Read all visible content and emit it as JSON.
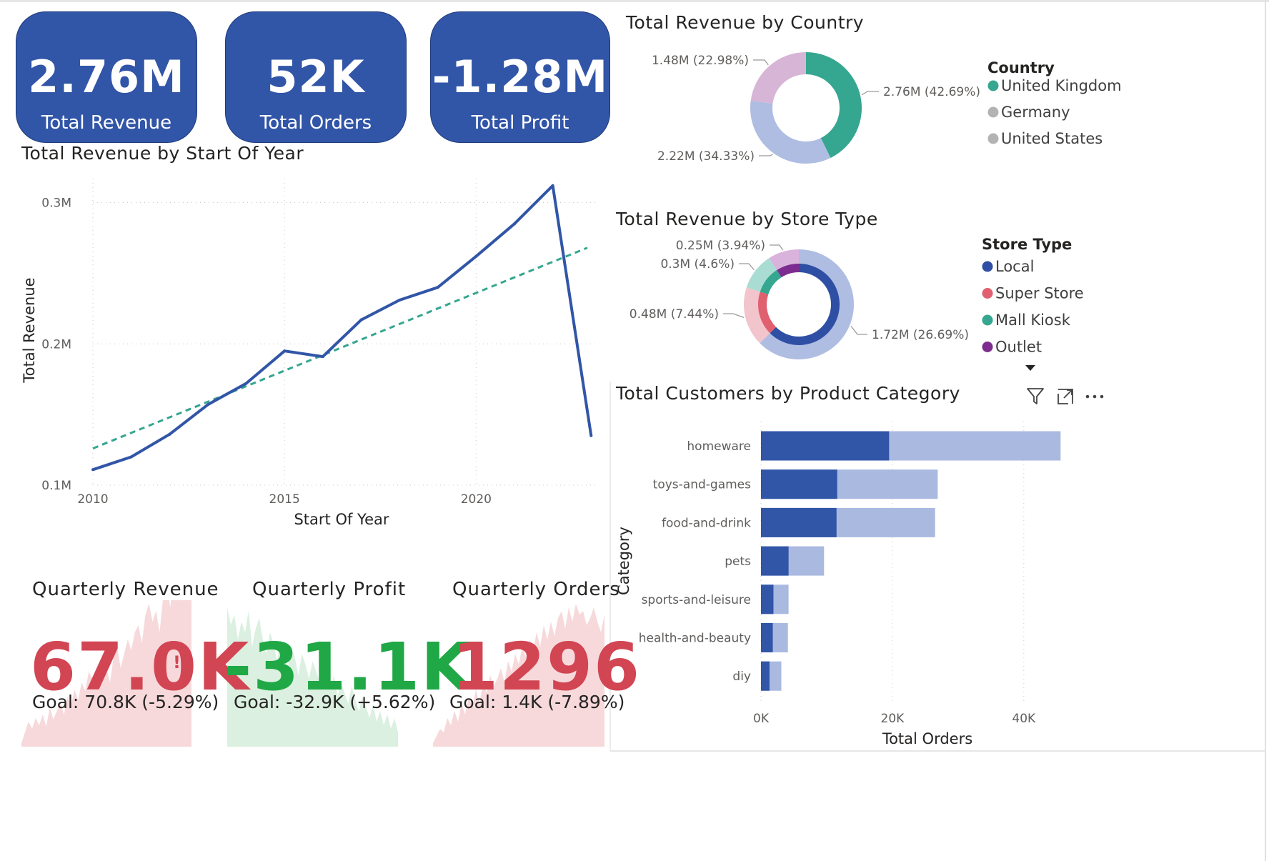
{
  "kpis": [
    {
      "value": "2.76M",
      "label": "Total Revenue"
    },
    {
      "value": "52K",
      "label": "Total Orders"
    },
    {
      "value": "-1.28M",
      "label": "Total Profit"
    }
  ],
  "cards": [
    {
      "title": "Quarterly Revenue",
      "value": "67.0K",
      "indicator": "!",
      "goal": "Goal: 70.8K (-5.29%)",
      "status": "below_goal"
    },
    {
      "title": "Quarterly Profit",
      "value": "-31.1K",
      "indicator": "✓",
      "goal": "Goal: -32.9K (+5.62%)",
      "status": "above_goal"
    },
    {
      "title": "Quarterly Orders",
      "value": "1296",
      "indicator": "!",
      "goal": "Goal: 1.4K (-7.89%)",
      "status": "below_goal"
    }
  ],
  "colors": {
    "primary": "#3155a7",
    "light_primary": "#a9b8e0",
    "teal": "#35a68f",
    "red": "#d24553",
    "green": "#1fa845",
    "red_fill": "#f7d9db",
    "green_fill": "#dbf0e0"
  },
  "chart_data": [
    {
      "type": "line",
      "title": "Total Revenue by Start Of Year",
      "xlabel": "Start Of Year",
      "ylabel": "Total Revenue",
      "x_ticks": [
        "2010",
        "2015",
        "2020"
      ],
      "y_ticks": [
        "0.1M",
        "0.2M",
        "0.3M"
      ],
      "xlim": [
        2010,
        2023.2
      ],
      "ylim": [
        0.1,
        0.32
      ],
      "grid": true,
      "series": [
        {
          "x": [
            2010,
            2011,
            2012,
            2013,
            2014,
            2015,
            2016,
            2017,
            2018,
            2019,
            2020,
            2021,
            2022,
            2023
          ],
          "y": [
            0.111,
            0.12,
            0.136,
            0.157,
            0.172,
            0.195,
            0.191,
            0.217,
            0.231,
            0.24,
            0.262,
            0.285,
            0.312,
            0.135
          ]
        }
      ],
      "trendline": {
        "x": [
          2010,
          2022.9
        ],
        "y": [
          0.126,
          0.268
        ]
      }
    },
    {
      "type": "pie",
      "title": "Total Revenue by Country",
      "legend_title": "Country",
      "legend_position": "right",
      "slices": [
        {
          "name": "United Kingdom",
          "value": 2.76,
          "label": "2.76M (42.69%)",
          "color": "#35a68f",
          "legend_color": "#35a68f"
        },
        {
          "name": "United States",
          "value": 2.22,
          "label": "2.22M (34.33%)",
          "color": "#aebde1",
          "legend_color": "#b3b3b3"
        },
        {
          "name": "Germany",
          "value": 1.48,
          "label": "1.48M (22.98%)",
          "color": "#d7b5d6",
          "legend_color": "#b3b3b3"
        }
      ],
      "legend": [
        "United Kingdom",
        "Germany",
        "United States"
      ]
    },
    {
      "type": "pie",
      "title": "Total Revenue by Store Type",
      "legend_title": "Store Type",
      "legend_position": "right",
      "legend": [
        {
          "name": "Local",
          "color": "#2e4fa3"
        },
        {
          "name": "Super Store",
          "color": "#e0606f"
        },
        {
          "name": "Mall Kiosk",
          "color": "#35a68f"
        },
        {
          "name": "Outlet",
          "color": "#7c2d8f"
        }
      ],
      "outer_slices": [
        {
          "value": 1.72,
          "label": "1.72M (26.69%)",
          "color": "#aebde1"
        },
        {
          "value": 0.48,
          "label": "0.48M (7.44%)",
          "color": "#f2c4cb"
        },
        {
          "value": 0.3,
          "label": "0.3M (4.6%)",
          "color": "#a9dcd3"
        },
        {
          "value": 0.25,
          "label": "0.25M (3.94%)",
          "color": "#d9b3dc"
        }
      ],
      "inner_slices": [
        {
          "name": "Local",
          "value": 1.72,
          "color": "#2e4fa3"
        },
        {
          "name": "Super Store",
          "value": 0.48,
          "color": "#e0606f"
        },
        {
          "name": "Mall Kiosk",
          "value": 0.3,
          "color": "#35a68f"
        },
        {
          "name": "Outlet",
          "value": 0.25,
          "color": "#7c2d8f"
        }
      ]
    },
    {
      "type": "bar",
      "orientation": "horizontal",
      "title": "Total Customers by Product Category",
      "xlabel": "Total Orders",
      "ylabel": "Category",
      "categories": [
        "homeware",
        "toys-and-games",
        "food-and-drink",
        "pets",
        "sports-and-leisure",
        "health-and-beauty",
        "diy"
      ],
      "x_ticks": [
        "0K",
        "20K",
        "40K"
      ],
      "xlim": [
        0,
        46000
      ],
      "series": [
        {
          "values": [
            19500,
            11600,
            11500,
            4200,
            1900,
            1800,
            1300
          ],
          "color": "#3155a7"
        },
        {
          "values": [
            45600,
            26900,
            26500,
            9600,
            4200,
            4100,
            3100
          ],
          "color": "#aab9e0"
        }
      ]
    }
  ]
}
